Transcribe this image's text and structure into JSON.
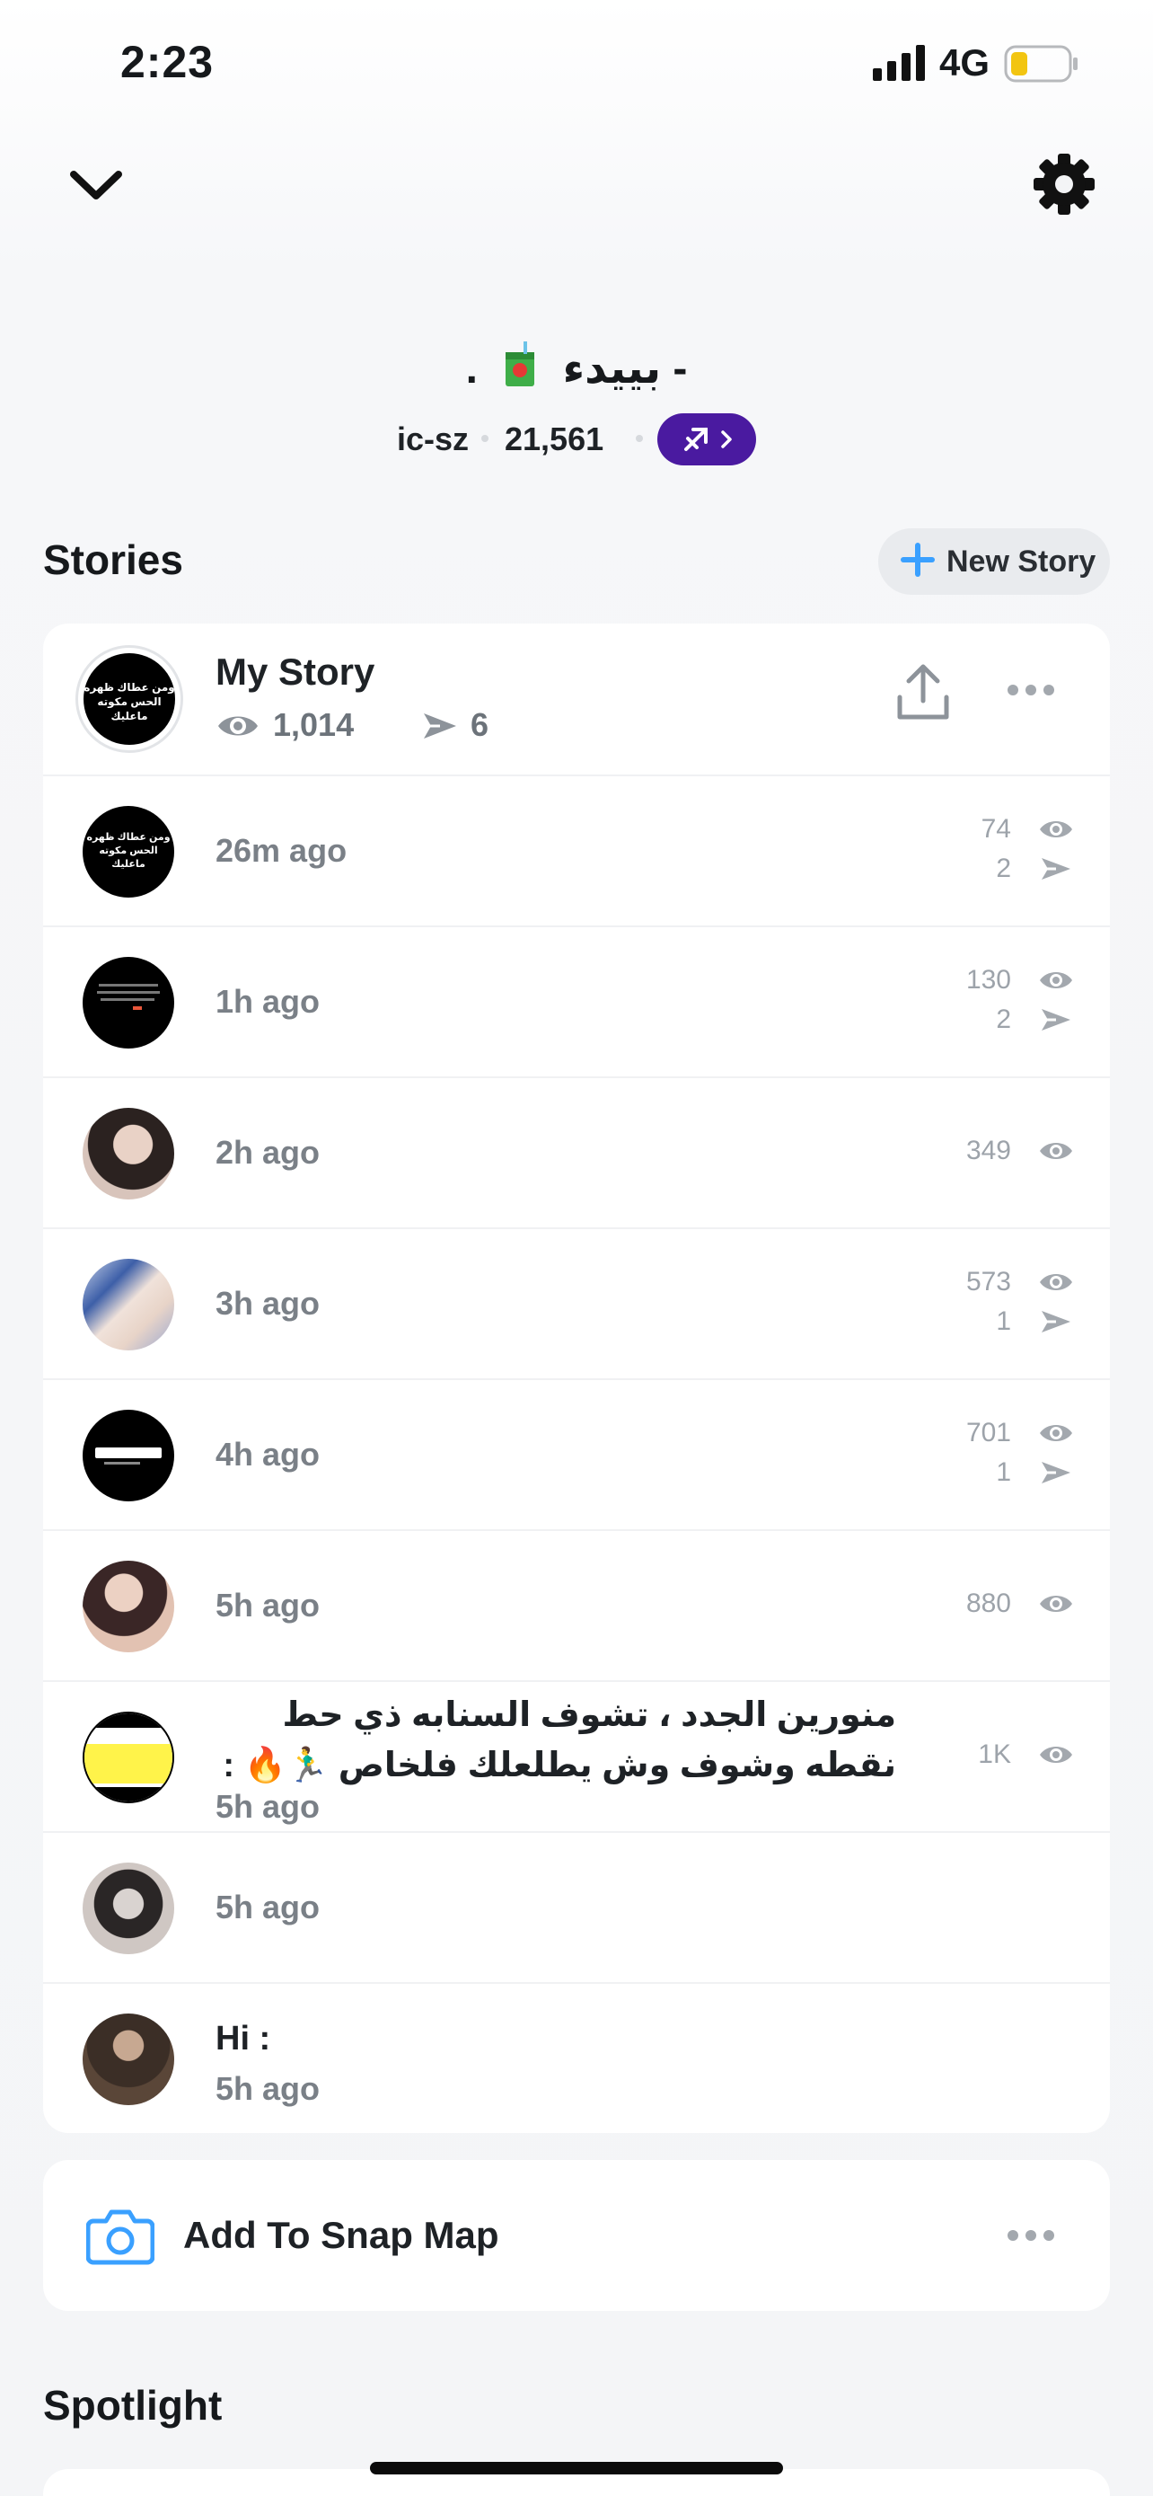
{
  "status_bar": {
    "time": "2:23",
    "network": "4G"
  },
  "profile": {
    "display_name_pre": "- بييدء",
    "display_name_post": ".",
    "username": "ic-sz",
    "score": "21,561"
  },
  "stories": {
    "title": "Stories",
    "new_story_label": "New Story",
    "my_story": {
      "title": "My Story",
      "views": "1,014",
      "shares": "6"
    },
    "items": [
      {
        "time": "26m ago",
        "views": "74",
        "shares": "2"
      },
      {
        "time": "1h ago",
        "views": "130",
        "shares": "2"
      },
      {
        "time": "2h ago",
        "views": "349"
      },
      {
        "time": "3h ago",
        "views": "573",
        "shares": "1"
      },
      {
        "time": "4h ago",
        "views": "701",
        "shares": "1"
      },
      {
        "time": "5h ago",
        "views": "880"
      },
      {
        "caption_line1": "منورين الجدد ، تشوف السنابه ذي حط",
        "caption_line2": "نقطه وشوف وش يطلعلك فلخاص 🏃‍♂️🔥 :",
        "time": "5h ago",
        "views": "1K"
      },
      {
        "time": "5h ago"
      },
      {
        "caption": "Hi :",
        "time": "5h ago"
      }
    ],
    "thumb_text": "ومن عطاك ظهره الحس مكوته ماعليك"
  },
  "snap_map": {
    "label": "Add To Snap Map"
  },
  "spotlight": {
    "title": "Spotlight"
  },
  "icons": [
    "chevron-down-icon",
    "gear-icon",
    "juice-box-icon",
    "sagittarius-icon",
    "plus-icon",
    "upload-icon",
    "more-icon",
    "eye-icon",
    "share-arrow-icon",
    "camera-icon"
  ],
  "colors": {
    "accent_blue": "#3aa0ff",
    "zodiac_purple": "#4a1aa0",
    "muted_text": "#9da3aa"
  }
}
